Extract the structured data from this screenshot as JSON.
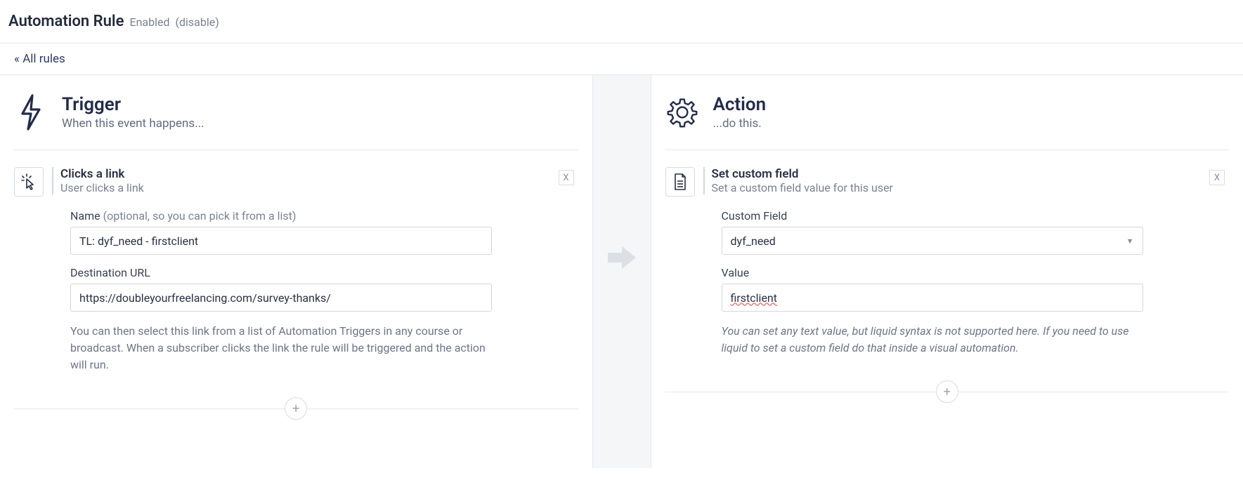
{
  "header": {
    "title": "Automation Rule",
    "status": "Enabled",
    "disable_link": "(disable)"
  },
  "nav": {
    "back_link": "« All rules"
  },
  "trigger": {
    "heading": "Trigger",
    "subheading": "When this event happens...",
    "block": {
      "title": "Clicks a link",
      "subtitle": "User clicks a link",
      "close": "X",
      "name_label": "Name",
      "name_hint": "(optional, so you can pick it from a list)",
      "name_value": "TL: dyf_need - firstclient",
      "url_label": "Destination URL",
      "url_value": "https://doubleyourfreelancing.com/survey-thanks/",
      "help": "You can then select this link from a list of Automation Triggers in any course or broadcast. When a subscriber clicks the link the rule will be triggered and the action will run."
    },
    "add": "+"
  },
  "action": {
    "heading": "Action",
    "subheading": "...do this.",
    "block": {
      "title": "Set custom field",
      "subtitle": "Set a custom field value for this user",
      "close": "X",
      "field_label": "Custom Field",
      "field_value": "dyf_need",
      "value_label": "Value",
      "value_value": "firstclient",
      "help": "You can set any text value, but liquid syntax is not supported here. If you need to use liquid to set a custom field do that inside a visual automation."
    },
    "add": "+"
  }
}
